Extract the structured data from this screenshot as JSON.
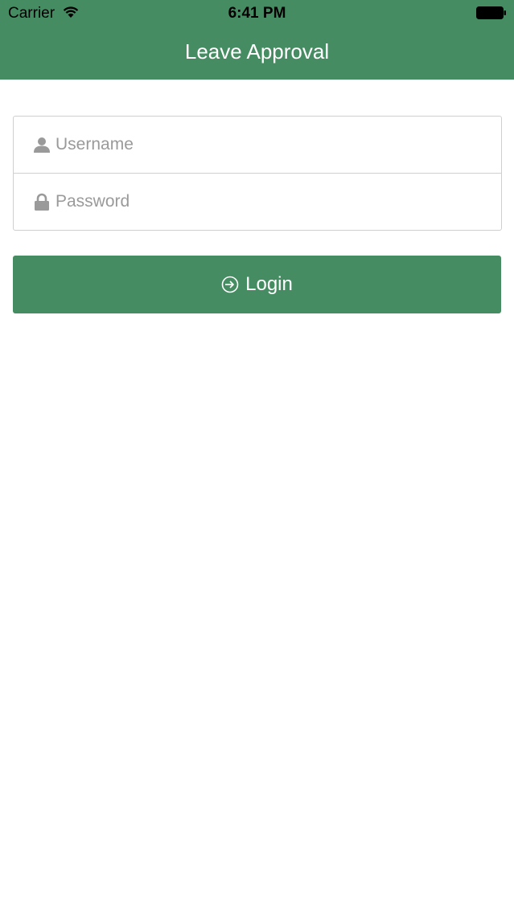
{
  "status_bar": {
    "carrier": "Carrier",
    "time": "6:41 PM",
    "icons": [
      "wifi-icon",
      "battery-icon"
    ]
  },
  "header": {
    "title": "Leave Approval",
    "background_color": "#468c62"
  },
  "login_form": {
    "username": {
      "placeholder": "Username",
      "value": "",
      "icon": "user-icon"
    },
    "password": {
      "placeholder": "Password",
      "value": "",
      "icon": "lock-icon"
    },
    "login_button": {
      "label": "Login",
      "icon": "login-icon",
      "color": "#468c62"
    }
  }
}
